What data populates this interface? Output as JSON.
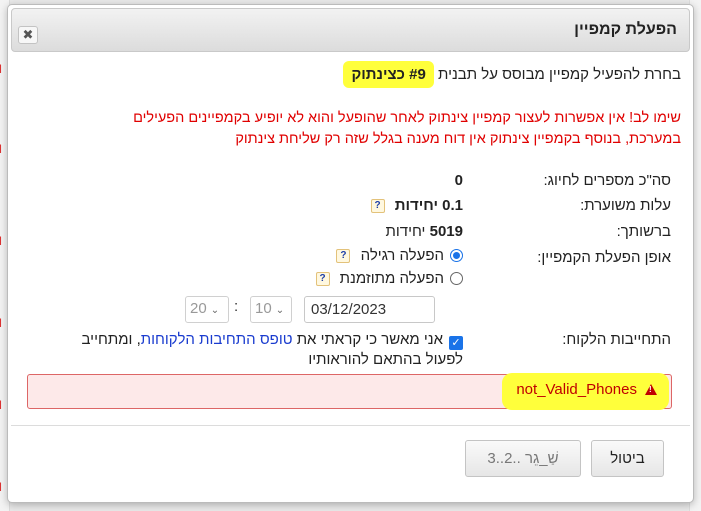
{
  "dialog": {
    "title": "הפעלת קמפיין",
    "close_label": "✖"
  },
  "intro": {
    "prefix": "בחרת להפעיל קמפיין מבוסס על תבנית",
    "template_name": "#9 כצינתוק"
  },
  "warning": {
    "line1": "שימו לב! אין אפשרות לעצור קמפיין צינתוק לאחר שהופעל והוא לא יופיע בקמפיינים הפעילים",
    "line2": "במערכת, בנוסף בקמפיין צינתוק אין דוח מענה בגלל שזה רק שליחת צינתוק"
  },
  "fields": {
    "total_numbers_label": "סה\"כ מספרים לחיוג:",
    "total_numbers_value": "0",
    "estimated_cost_label": "עלות משוערת:",
    "estimated_cost_value": "0.1 יחידות",
    "balance_label": "ברשותך:",
    "balance_value": "5019 יחידות",
    "activation_mode_label": "אופן הפעלת הקמפיין:",
    "mode_regular": "הפעלה רגילה",
    "mode_scheduled": "הפעלה מתוזמנת",
    "help_icon": "?",
    "date_value": "03/12/2023",
    "hour_value": "20",
    "minute_value": "10",
    "time_separator": ":",
    "commitment_label": "התחייבות הלקוח:",
    "commitment_text_1": "אני מאשר כי קראתי את",
    "commitment_link": "טופס התחיבות הלקוחות",
    "commitment_text_2": ", ומתחייב",
    "commitment_text_3": "לפעול בהתאם להוראותיו"
  },
  "error": {
    "message": "not_Valid_Phones"
  },
  "buttons": {
    "cancel": "ביטול",
    "send": "3..2.. שַׁ_גֵר"
  },
  "background": {
    "mark": "וי"
  },
  "colors": {
    "highlight": "#ffff3b",
    "warning_text": "#e00000",
    "error_bg": "#fde9e9",
    "link": "#1a3ccf",
    "accent": "#1a73e8"
  }
}
